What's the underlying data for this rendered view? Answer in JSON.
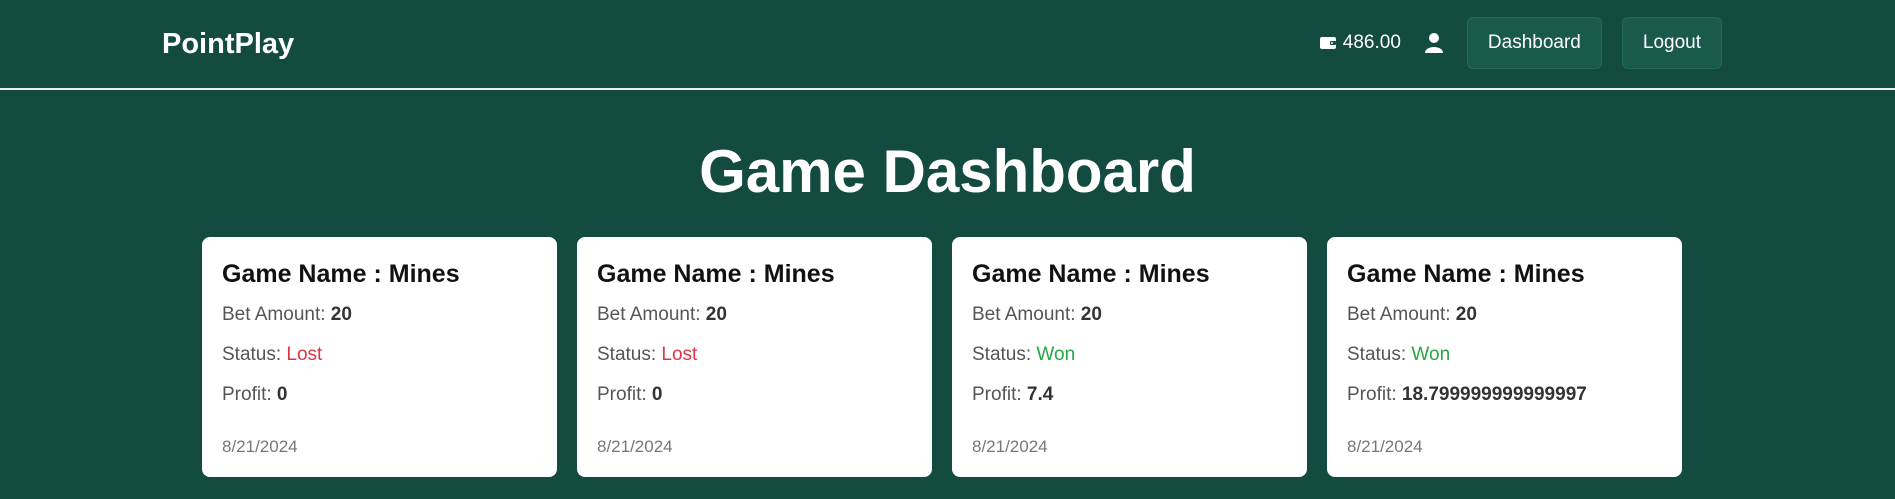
{
  "nav": {
    "brand": "PointPlay",
    "wallet_balance": "486.00",
    "dashboard_label": "Dashboard",
    "logout_label": "Logout",
    "icons": [
      "wallet-icon",
      "user-icon"
    ]
  },
  "page": {
    "title": "Game Dashboard"
  },
  "labels": {
    "game_name_prefix": "Game Name : ",
    "bet_amount": "Bet Amount: ",
    "status": "Status: ",
    "profit": "Profit: "
  },
  "colors": {
    "background": "#134b40",
    "lost": "#dc3545",
    "won": "#28a745"
  },
  "cards": [
    {
      "game": "Mines",
      "bet": "20",
      "status": "Lost",
      "profit": "0",
      "date": "8/21/2024"
    },
    {
      "game": "Mines",
      "bet": "20",
      "status": "Lost",
      "profit": "0",
      "date": "8/21/2024"
    },
    {
      "game": "Mines",
      "bet": "20",
      "status": "Won",
      "profit": "7.4",
      "date": "8/21/2024"
    },
    {
      "game": "Mines",
      "bet": "20",
      "status": "Won",
      "profit": "18.799999999999997",
      "date": "8/21/2024"
    }
  ]
}
